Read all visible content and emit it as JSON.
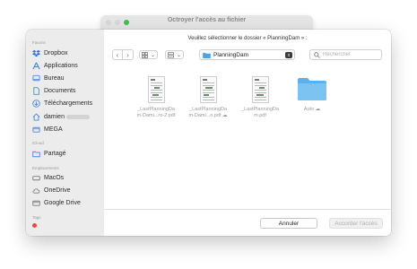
{
  "background_window": {
    "title": "Octroyer l'accès au fichier"
  },
  "dialog": {
    "prompt": "Veuillez sélectionner le dossier « PlanningDam » :",
    "sidebar": {
      "sections": [
        {
          "label": "Favoris",
          "items": [
            {
              "label": "Dropbox",
              "icon": "dropbox-icon"
            },
            {
              "label": "Applications",
              "icon": "applications-icon"
            },
            {
              "label": "Bureau",
              "icon": "desktop-icon"
            },
            {
              "label": "Documents",
              "icon": "document-icon"
            },
            {
              "label": "Téléchargements",
              "icon": "download-icon"
            },
            {
              "label": "damien",
              "icon": "home-icon"
            },
            {
              "label": "MEGA",
              "icon": "drive-icon"
            }
          ]
        },
        {
          "label": "iCloud",
          "items": [
            {
              "label": "Partagé",
              "icon": "shared-folder-icon"
            }
          ]
        },
        {
          "label": "Emplacements",
          "items": [
            {
              "label": "MacOs",
              "icon": "disk-icon"
            },
            {
              "label": "OneDrive",
              "icon": "cloud-icon"
            },
            {
              "label": "Google Drive",
              "icon": "drive-icon"
            }
          ]
        },
        {
          "label": "Tags",
          "items": []
        }
      ]
    },
    "toolbar": {
      "location": "PlanningDam",
      "search_placeholder": "Rechercher"
    },
    "files": [
      {
        "name_line1": "_LastPlanningDa",
        "name_line2": "m-Dami...ro-2.pdf",
        "type": "pdf"
      },
      {
        "name_line1": "_LastPlanningDa",
        "name_line2": "m-Dami...o.pdf ☁",
        "type": "pdf"
      },
      {
        "name_line1": "_LastPlanningDa",
        "name_line2": "m.pdf",
        "type": "pdf"
      },
      {
        "name_line1": "Auto ☁",
        "name_line2": "",
        "type": "folder"
      }
    ],
    "footer": {
      "cancel_label": "Annuler",
      "grant_label": "Accorder l'accès"
    }
  },
  "colors": {
    "accent": "#4a88d8",
    "folder": "#6cb7ee",
    "sidebar_bg": "#ececec"
  }
}
